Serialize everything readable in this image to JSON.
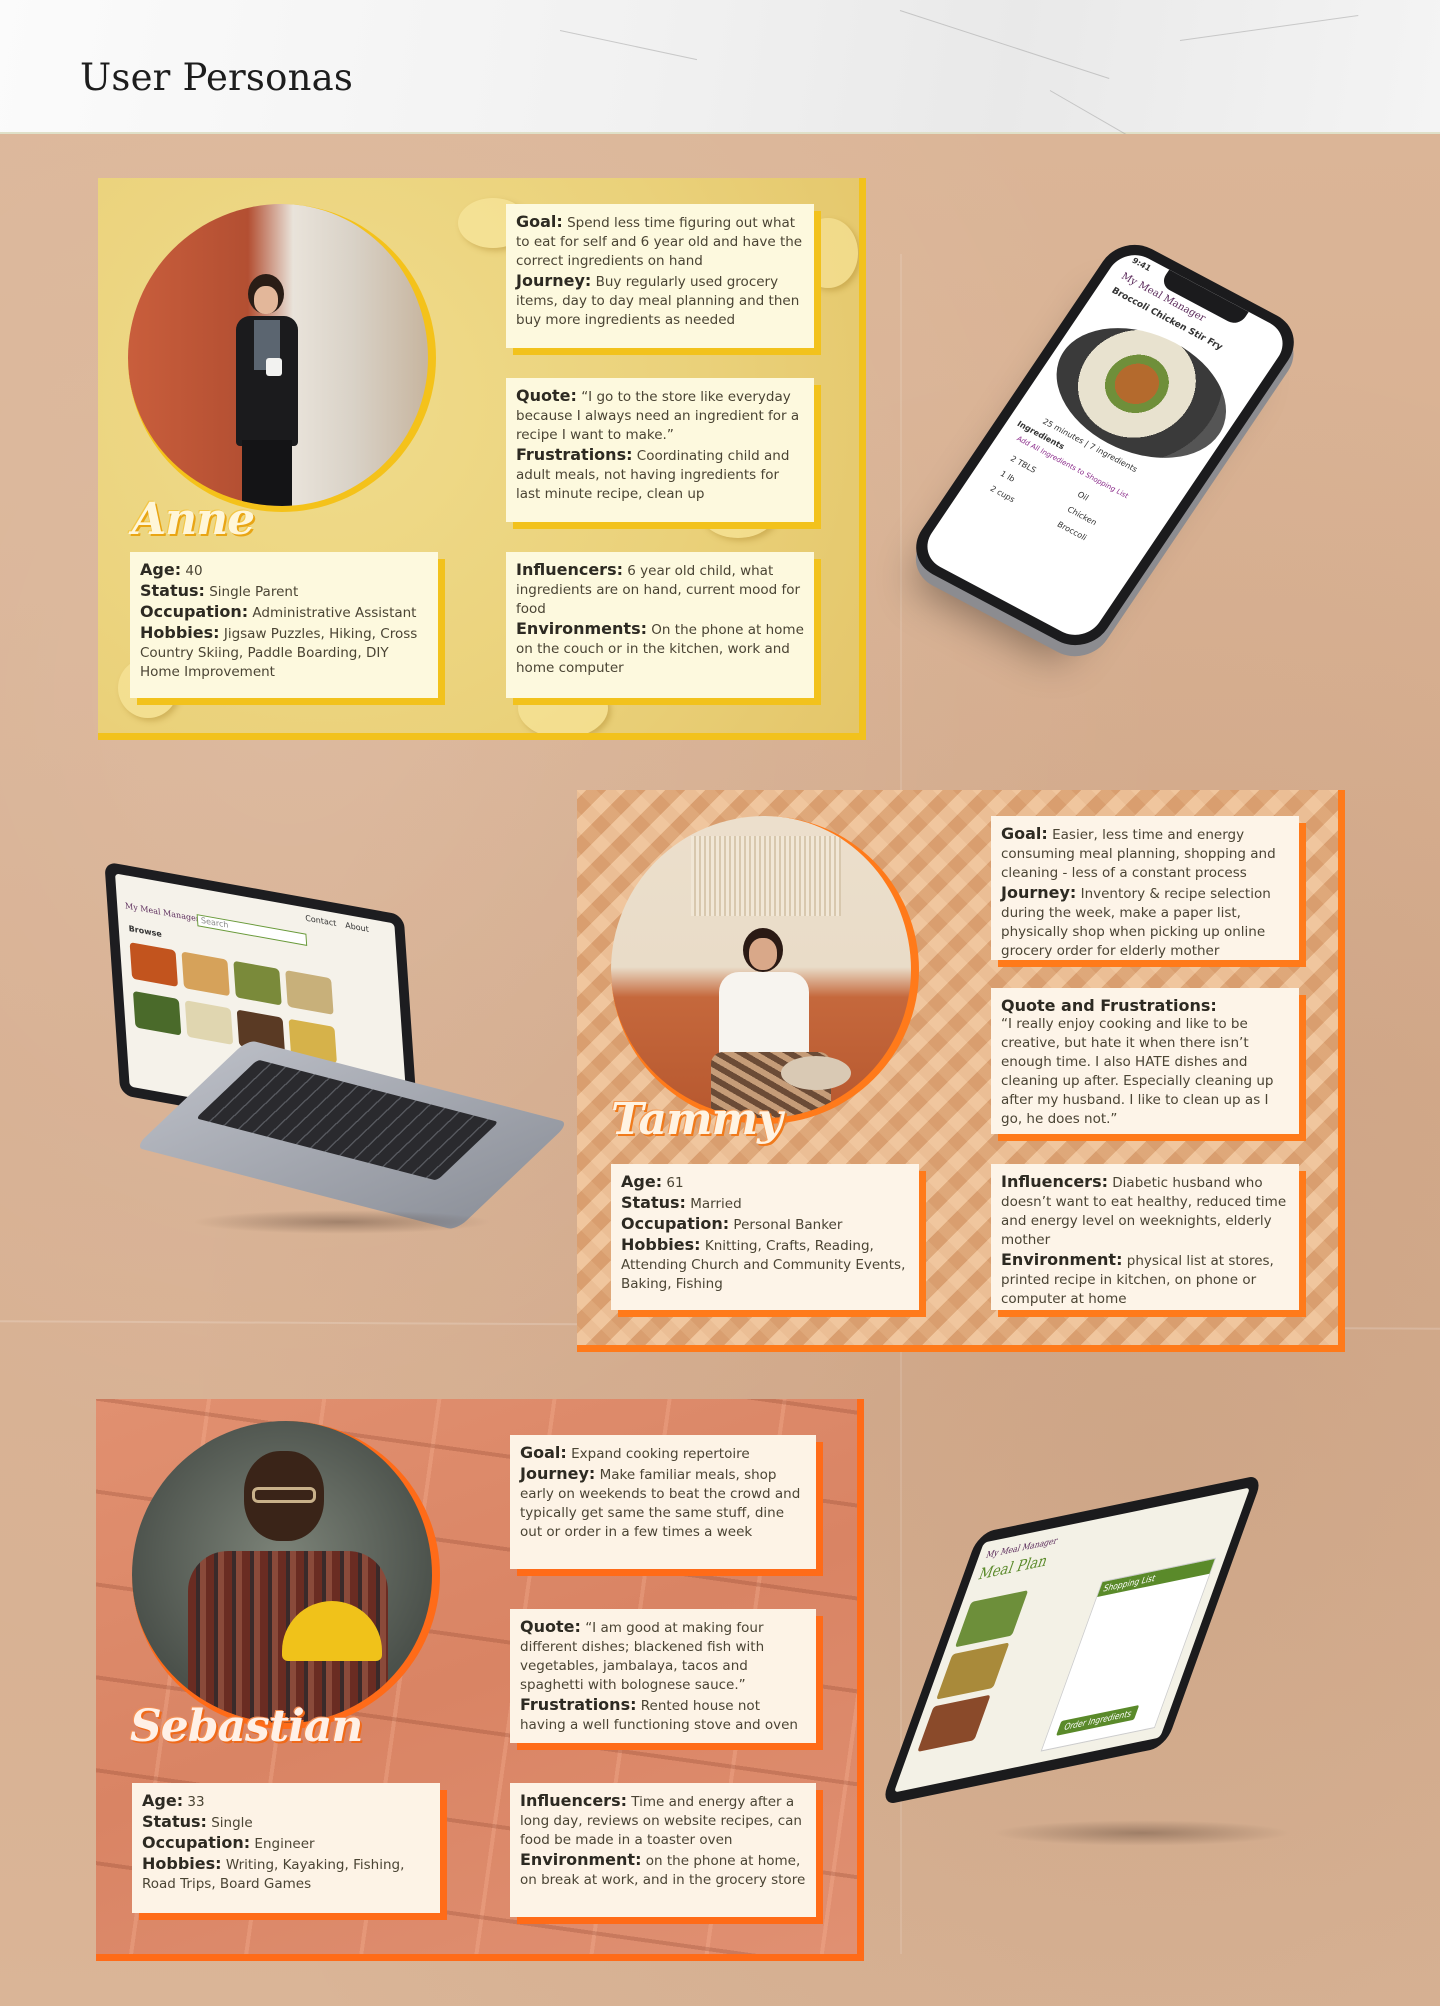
{
  "page": {
    "title": "User Personas"
  },
  "personas": [
    {
      "name": "Anne",
      "age_label": "Age:",
      "age": "40",
      "status_label": "Status:",
      "status": "Single Parent",
      "occupation_label": "Occupation:",
      "occupation": "Administrative Assistant",
      "hobbies_label": "Hobbies:",
      "hobbies": "Jigsaw Puzzles, Hiking, Cross Country Skiing, Paddle Boarding, DIY Home Improvement",
      "goal_label": "Goal:",
      "goal": "Spend less time figuring out what to eat for self and 6 year old and have the correct ingredients on hand",
      "journey_label": "Journey:",
      "journey": "Buy regularly used grocery items, day to day meal planning and then buy more ingredients as needed",
      "quote_label": "Quote:",
      "quote": "“I go to the store like everyday because I always need an ingredient for a recipe I want to make.”",
      "frustrations_label": "Frustrations:",
      "frustrations": "Coordinating child and adult meals, not having ingredients for last minute recipe, clean up",
      "influencers_label": "Influencers:",
      "influencers": "6 year old child, what ingredients are on hand, current mood for food",
      "environments_label": "Environments:",
      "environments": "On the phone at home on the couch or in the kitchen, work and home computer"
    },
    {
      "name": "Tammy",
      "age_label": "Age:",
      "age": "61",
      "status_label": "Status:",
      "status": "Married",
      "occupation_label": "Occupation:",
      "occupation": "Personal Banker",
      "hobbies_label": "Hobbies:",
      "hobbies": "Knitting, Crafts, Reading, Attending Church and Community Events, Baking, Fishing",
      "goal_label": "Goal:",
      "goal": "Easier, less time and energy consuming meal planning, shopping and cleaning - less of a constant process",
      "journey_label": "Journey:",
      "journey": "Inventory & recipe selection during the week, make a paper list, physically shop when picking up online grocery order for elderly mother",
      "quote_label": "Quote and Frustrations:",
      "quote": "“I really enjoy cooking and like to be creative, but hate it when there isn’t enough time. I also HATE dishes and cleaning up after. Especially cleaning up after my husband. I like to clean up as I go, he does not.”",
      "influencers_label": "Influencers:",
      "influencers": "Diabetic husband who doesn’t want to eat healthy, reduced time and energy level on weeknights, elderly mother",
      "environments_label": "Environment:",
      "environments": "physical list at stores, printed recipe in kitchen, on phone or computer at home"
    },
    {
      "name": "Sebastian",
      "age_label": "Age:",
      "age": "33",
      "status_label": "Status:",
      "status": "Single",
      "occupation_label": "Occupation:",
      "occupation": "Engineer",
      "hobbies_label": "Hobbies:",
      "hobbies": "Writing, Kayaking, Fishing, Road Trips, Board Games",
      "goal_label": "Goal:",
      "goal": "Expand cooking repertoire",
      "journey_label": "Journey:",
      "journey": "Make familiar meals, shop early on weekends to beat the crowd and typically get same the same stuff, dine out or order in a few times a week",
      "quote_label": "Quote:",
      "quote": "“I am good at making four different dishes; blackened fish with vegetables, jambalaya, tacos and spaghetti with bolognese sauce.”",
      "frustrations_label": "Frustrations:",
      "frustrations": "Rented house not having a well functioning stove and oven",
      "influencers_label": "Influencers:",
      "influencers": "Time and energy after a long day, reviews on website recipes, can food be made in a toaster oven",
      "environments_label": "Environment:",
      "environments": "on the phone at home, on break at work, and in the grocery store"
    }
  ],
  "devices": {
    "phone": {
      "time": "9:41",
      "app_name": "My Meal Manager",
      "recipe_title": "Broccoli Chicken Stir Fry",
      "meta": "25 minutes | 7 ingredients",
      "section": "Ingredients",
      "add_all": "Add All Ingredients to Shopping List",
      "ingredients": [
        {
          "qty": "2 TBLS",
          "item": "Oil"
        },
        {
          "qty": "1 lb",
          "item": "Chicken"
        },
        {
          "qty": "2 cups",
          "item": "Broccoli"
        }
      ]
    },
    "laptop": {
      "app_name": "My Meal Manager",
      "search_placeholder": "Search",
      "section": "Browse",
      "nav_contact": "Contact",
      "nav_about": "About"
    },
    "tablet": {
      "app_name": "My Meal Manager",
      "title": "Meal Plan",
      "panel": "Shopping List",
      "cta": "Order Ingredients"
    }
  },
  "colors": {
    "anne_accent": "#f2c21c",
    "tammy_accent": "#ff7a1a",
    "sebastian_accent": "#ff6b18",
    "app_green": "#5a8a2a",
    "app_purple": "#8a2a8a"
  }
}
